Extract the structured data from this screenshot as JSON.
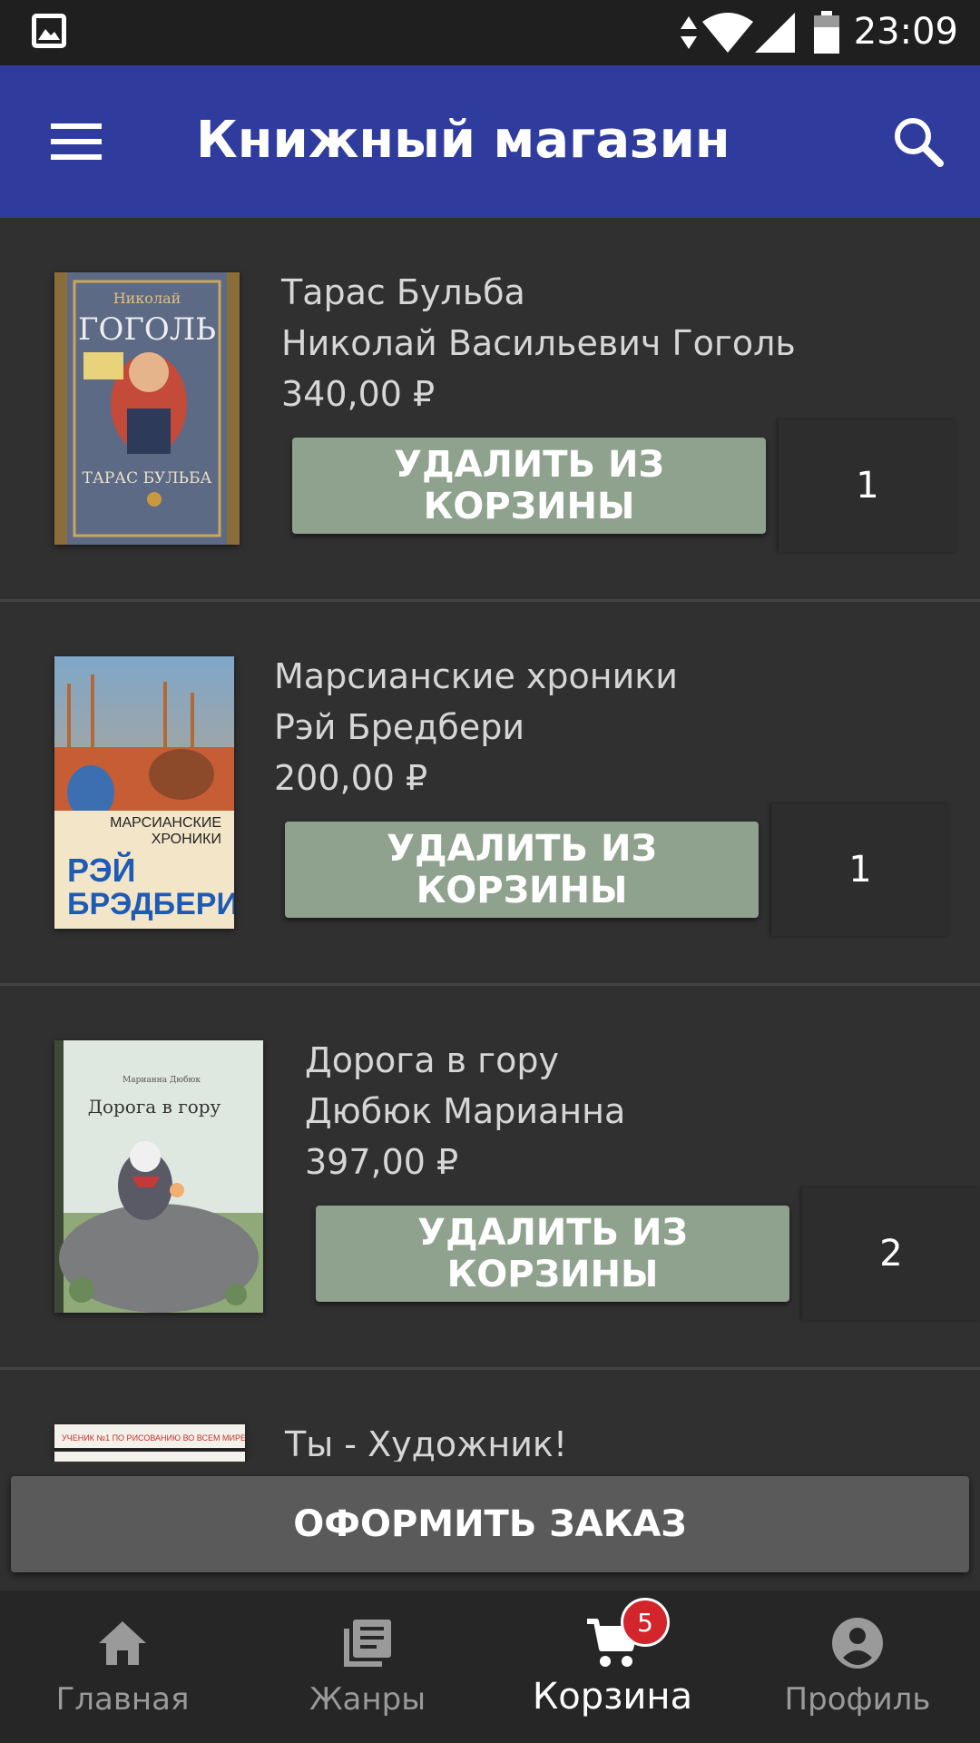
{
  "status_bar": {
    "time": "23:09"
  },
  "app_bar": {
    "title": "Книжный магазин"
  },
  "cart": {
    "items": [
      {
        "title": "Тарас Бульба",
        "author": "Николай Васильевич Гоголь",
        "price": "340,00 ₽",
        "remove_label": "УДАЛИТЬ ИЗ КОРЗИНЫ",
        "quantity": "1"
      },
      {
        "title": "Марсианские хроники",
        "author": "Рэй Бредбери",
        "price": "200,00 ₽",
        "remove_label": "УДАЛИТЬ ИЗ КОРЗИНЫ",
        "quantity": "1"
      },
      {
        "title": "Дорога в гору",
        "author": "Дюбюк Марианна",
        "price": "397,00 ₽",
        "remove_label": "УДАЛИТЬ ИЗ КОРЗИНЫ",
        "quantity": "2"
      },
      {
        "title": "Ты - Художник!"
      }
    ],
    "covers": {
      "gogol": {
        "top": "Николай",
        "name": "ГОГОЛЬ",
        "bottom": "ТАРАС БУЛЬБА"
      },
      "bradbury": {
        "title1": "МАРСИАНСКИЕ",
        "title2": "ХРОНИКИ",
        "author1": "РЭЙ",
        "author2": "БРЭДБЕРИ"
      },
      "dubuc": {
        "author": "Марианна Дюбюк",
        "title": "Дорога в гору"
      },
      "artist": {
        "banner": "УЧЕНИК №1 ПО РИСОВАНИЮ ВО ВСЕМ МИРЕ"
      }
    }
  },
  "checkout_label": "ОФОРМИТЬ ЗАКАЗ",
  "bottom_nav": {
    "items": [
      {
        "label": "Главная",
        "icon": "home-icon"
      },
      {
        "label": "Жанры",
        "icon": "library-books-icon"
      },
      {
        "label": "Корзина",
        "icon": "cart-icon",
        "active": true,
        "badge": "5"
      },
      {
        "label": "Профиль",
        "icon": "account-circle-icon"
      }
    ]
  },
  "colors": {
    "app_bar": "#2f3c9e",
    "remove_button": "#8fa28e",
    "badge": "#d3262c",
    "background": "#303030"
  }
}
